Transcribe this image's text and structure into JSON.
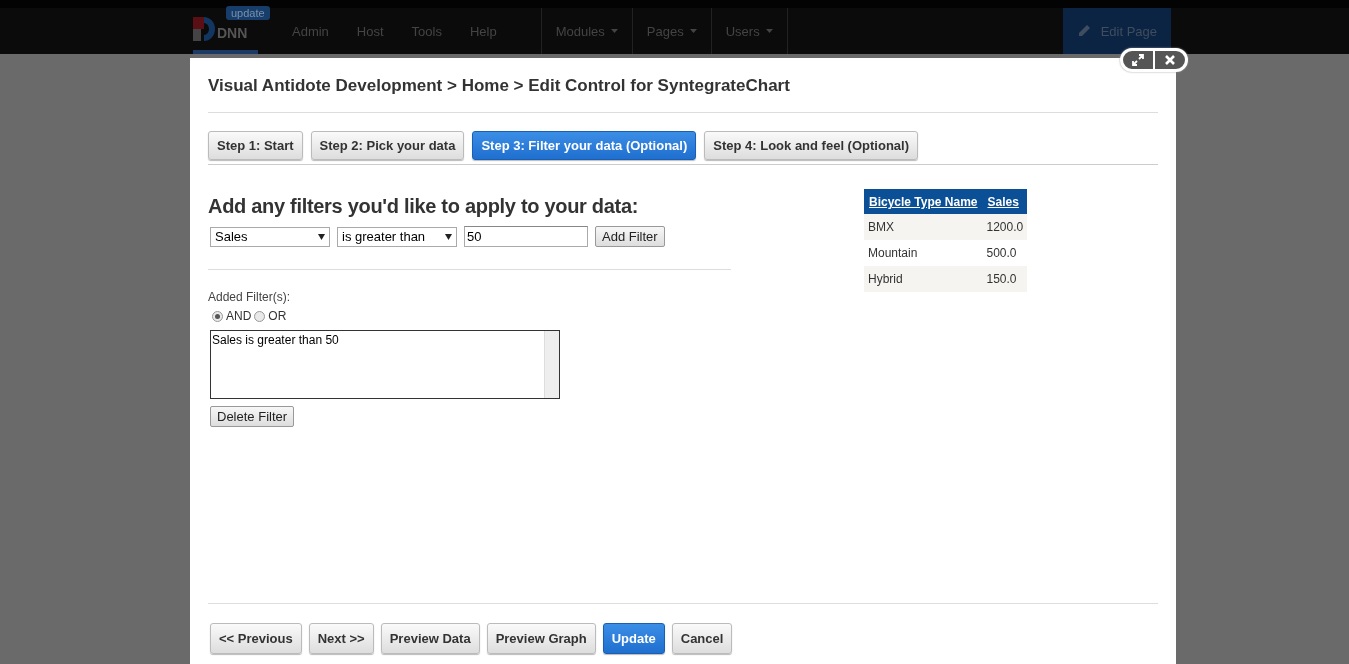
{
  "topbar": {
    "logo_text": "DNN",
    "update_badge": "update",
    "nav": [
      "Admin",
      "Host",
      "Tools",
      "Help"
    ],
    "menus": [
      "Modules",
      "Pages",
      "Users"
    ],
    "edit_page_button": "Edit Page"
  },
  "dialog": {
    "title": "Visual Antidote Development > Home > Edit Control for SyntegrateChart",
    "steps": [
      {
        "label": "Step 1: Start",
        "selected": false
      },
      {
        "label": "Step 2: Pick your data",
        "selected": false
      },
      {
        "label": "Step 3: Filter your data (Optional)",
        "selected": true
      },
      {
        "label": "Step 4: Look and feel (Optional)",
        "selected": false
      }
    ],
    "heading": "Add any filters you'd like to apply to your data:",
    "field_select": "Sales",
    "operator_select": "is greater than",
    "value_input": "50",
    "add_filter_button": "Add Filter",
    "added_label": "Added Filter(s):",
    "combine": [
      {
        "label": "AND",
        "selected": true
      },
      {
        "label": "OR",
        "selected": false
      }
    ],
    "added_filters": [
      "Sales is greater than 50"
    ],
    "delete_filter_button": "Delete Filter",
    "table": {
      "columns": [
        "Bicycle Type Name",
        "Sales"
      ],
      "rows": [
        [
          "BMX",
          "1200.0"
        ],
        [
          "Mountain",
          "500.0"
        ],
        [
          "Hybrid",
          "150.0"
        ]
      ]
    },
    "footer_buttons": [
      {
        "label": "<< Previous",
        "kind": "default"
      },
      {
        "label": "Next >>",
        "kind": "default"
      },
      {
        "label": "Preview Data",
        "kind": "default"
      },
      {
        "label": "Preview Graph",
        "kind": "default"
      },
      {
        "label": "Update",
        "kind": "primary"
      },
      {
        "label": "Cancel",
        "kind": "default"
      }
    ]
  }
}
